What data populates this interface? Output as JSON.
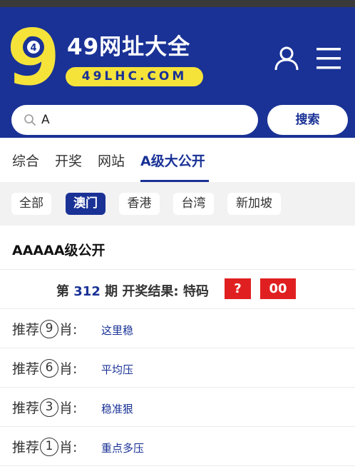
{
  "header": {
    "logo_digit": "9",
    "logo_ball": "4",
    "brand_title": "49网址大全",
    "brand_domain": "49LHC.COM",
    "colors": {
      "primary": "#1a3296",
      "accent": "#f6e33a",
      "badge": "#e02020"
    }
  },
  "icons": {
    "user": "user-icon",
    "menu": "menu-icon",
    "search": "search-icon"
  },
  "search": {
    "value": "A",
    "button_label": "搜索"
  },
  "tabs": [
    {
      "label": "综合",
      "active": false
    },
    {
      "label": "开奖",
      "active": false
    },
    {
      "label": "网站",
      "active": false
    },
    {
      "label": "A级大公开",
      "active": true
    }
  ],
  "regions": [
    {
      "label": "全部",
      "active": false
    },
    {
      "label": "澳门",
      "active": true
    },
    {
      "label": "香港",
      "active": false
    },
    {
      "label": "台湾",
      "active": false
    },
    {
      "label": "新加坡",
      "active": false
    }
  ],
  "panel": {
    "title": "AAAAA级公开",
    "issue_pre": "第",
    "issue_number": "312",
    "issue_post": "期 开奖结果: 特码",
    "result_badge_1": "?",
    "result_badge_2": "00",
    "recommend_prefix": "推荐",
    "recommend_suffix": "肖:",
    "recommendations": [
      {
        "count": "9",
        "value": "这里稳"
      },
      {
        "count": "6",
        "value": "平均压"
      },
      {
        "count": "3",
        "value": "稳准狠"
      },
      {
        "count": "1",
        "value": "重点多压"
      }
    ]
  }
}
